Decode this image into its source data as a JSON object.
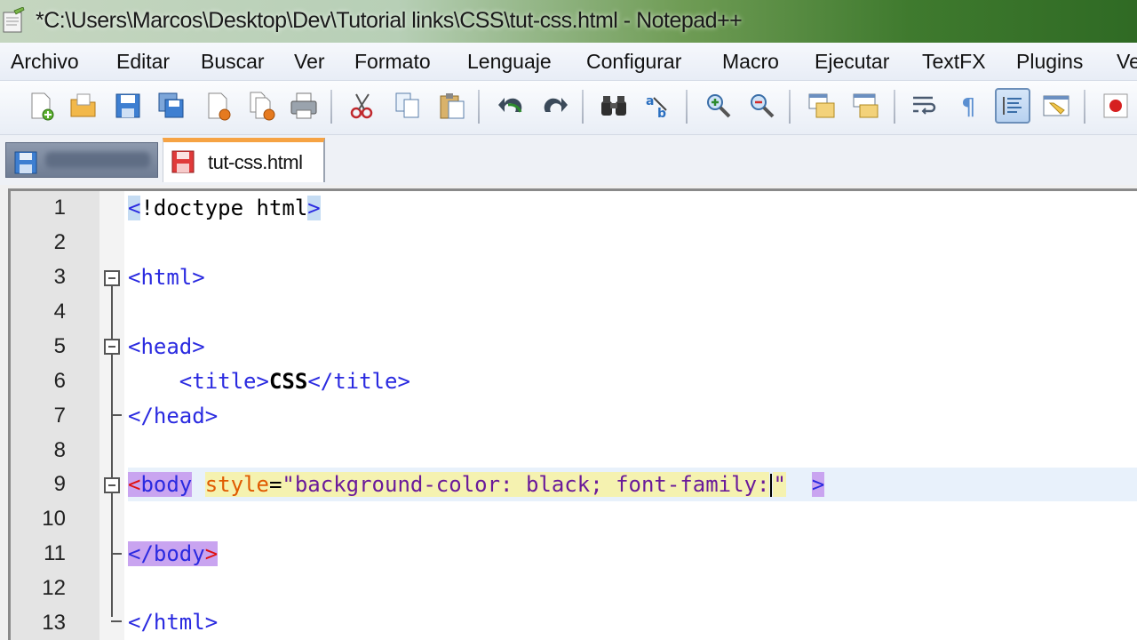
{
  "window": {
    "title": "*C:\\Users\\Marcos\\Desktop\\Dev\\Tutorial links\\CSS\\tut-css.html - Notepad++"
  },
  "menu": {
    "items": [
      "Archivo",
      "Editar",
      "Buscar",
      "Ver",
      "Formato",
      "Lenguaje",
      "Configurar",
      "Macro",
      "Ejecutar",
      "TextFX",
      "Plugins",
      "Ve"
    ]
  },
  "toolbar": {
    "icons": [
      "new-file",
      "open-file",
      "save",
      "save-all",
      "close",
      "close-all",
      "print",
      "cut",
      "copy",
      "paste",
      "undo",
      "redo",
      "find",
      "replace",
      "zoom-in",
      "zoom-out",
      "sync-vertical",
      "sync-horizontal",
      "word-wrap",
      "show-all-chars",
      "indent-guide",
      "user-defined-language",
      "record-macro"
    ]
  },
  "tabs": [
    {
      "label": "",
      "active": false,
      "icon": "saved-file-icon"
    },
    {
      "label": "tut-css.html",
      "active": true,
      "icon": "unsaved-file-icon"
    }
  ],
  "editor": {
    "line_numbers": [
      "1",
      "2",
      "3",
      "4",
      "5",
      "6",
      "7",
      "8",
      "9",
      "10",
      "11",
      "12",
      "13"
    ],
    "l1": {
      "open": "<",
      "rest": "!doctype html",
      "close": ">"
    },
    "l3": "<html>",
    "l5": "<head>",
    "l6": {
      "indent": "    ",
      "open_tag": "<title>",
      "text": "CSS",
      "close_tag": "</title>"
    },
    "l7": "</head>",
    "l9": {
      "lt": "<",
      "tag": "body",
      "space": " ",
      "attr": "style",
      "eq": "=",
      "value": "\"background-color: black; font-family:",
      "value_end": "\"",
      "gt": ">"
    },
    "l11": {
      "tag": "</body",
      "gt": ">"
    },
    "l13": "</html>"
  },
  "colors": {
    "tag": "#2a2ae0",
    "attribute": "#e05a00",
    "string": "#6a1a9a",
    "active_tab_accent": "#f6a343"
  }
}
